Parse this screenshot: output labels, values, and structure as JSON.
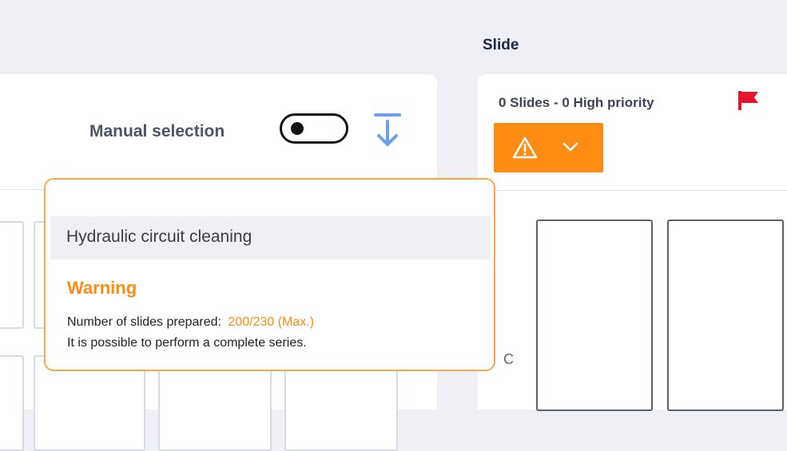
{
  "header": {
    "title": "Slide"
  },
  "left_panel": {
    "manual_selection_label": "Manual selection",
    "manual_selection_on": false
  },
  "right_panel": {
    "slides_count_text": "0 Slides - 0 High priority",
    "colors": {
      "accent_orange": "#ff8c13",
      "flag_red": "#e8132b",
      "sort_blue": "#6f9ff2"
    },
    "row_label": "C"
  },
  "tooltip": {
    "title": "Hydraulic circuit cleaning",
    "status": "Warning",
    "line1_prefix": "Number of slides prepared:",
    "line1_value": "200/230 (Max.)",
    "line2": "It is possible to perform a complete series."
  },
  "icons": {
    "toggle": "toggle-switch-icon",
    "sort": "sort-to-bottom-icon",
    "flag": "flag-icon",
    "warning": "warning-triangle-icon",
    "chevron": "chevron-down-icon"
  }
}
